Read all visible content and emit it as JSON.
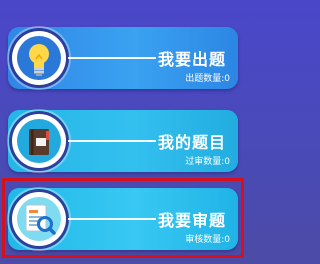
{
  "menu": {
    "items": [
      {
        "title": "我要出题",
        "count_label": "出题数量",
        "count": "0",
        "icon": "lightbulb-icon"
      },
      {
        "title": "我的题目",
        "count_label": "过审数量",
        "count": "0",
        "icon": "notebook-icon"
      },
      {
        "title": "我要审题",
        "count_label": "审核数量",
        "count": "0",
        "icon": "review-document-icon"
      }
    ]
  },
  "colors": {
    "background": "#4a48c0",
    "card_blue": "#2f86e6",
    "card_cyan": "#33c0ef",
    "highlight_border": "#d6101d"
  }
}
